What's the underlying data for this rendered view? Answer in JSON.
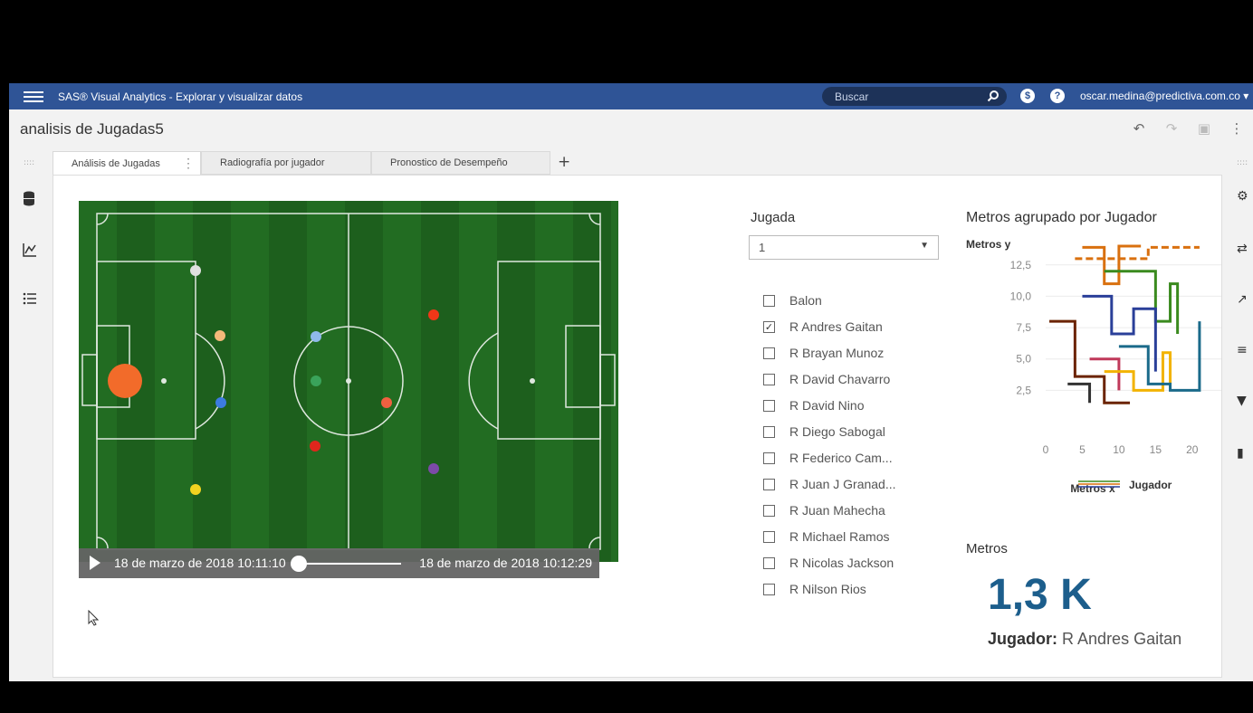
{
  "app": {
    "title": "SAS® Visual Analytics - Explorar y visualizar datos",
    "search_placeholder": "Buscar",
    "user": "oscar.medina@predictiva.com.co ▾",
    "bar_color": "#2f5496"
  },
  "document": {
    "title": "analisis de Jugadas5",
    "actions": [
      "undo-icon",
      "redo-icon",
      "save-icon",
      "more-icon"
    ]
  },
  "tabs": [
    {
      "label": "Análisis de Jugadas",
      "active": true
    },
    {
      "label": "Radiografía por jugador",
      "active": false
    },
    {
      "label": "Pronostico de Desempeño",
      "active": false
    }
  ],
  "add_tab_label": "+",
  "player": {
    "start_time": "18 de marzo de 2018 10:11:10",
    "end_time": "18 de marzo de 2018 10:12:29",
    "position_fraction": 0.0
  },
  "filter": {
    "label": "Jugada",
    "selected": "1",
    "options": [
      {
        "label": "Balon",
        "checked": false
      },
      {
        "label": "R Andres Gaitan",
        "checked": true
      },
      {
        "label": "R Brayan Munoz",
        "checked": false
      },
      {
        "label": "R David Chavarro",
        "checked": false
      },
      {
        "label": "R David Nino",
        "checked": false
      },
      {
        "label": "R Diego Sabogal",
        "checked": false
      },
      {
        "label": "R Federico Cam...",
        "checked": false
      },
      {
        "label": "R Juan J Granad...",
        "checked": false
      },
      {
        "label": "R Juan Mahecha",
        "checked": false
      },
      {
        "label": "R Michael Ramos",
        "checked": false
      },
      {
        "label": "R Nicolas Jackson",
        "checked": false
      },
      {
        "label": "R Nilson Rios",
        "checked": false
      }
    ]
  },
  "chart_data": {
    "type": "line",
    "title": "Metros agrupado por Jugador",
    "xlabel": "Metros x",
    "ylabel": "Metros y",
    "xlim": [
      0,
      22
    ],
    "ylim": [
      0,
      14
    ],
    "x_ticks": [
      "0",
      "5",
      "10",
      "15",
      "20"
    ],
    "y_ticks": [
      "2,5",
      "5,0",
      "7,5",
      "10,0",
      "12,5"
    ],
    "legend_title": "Jugador",
    "grid": true
  },
  "kpi": {
    "title": "Metros",
    "value": "1,3 K",
    "sub_label": "Jugador:",
    "sub_value": "R Andres Gaitan",
    "color": "#1c5e8c"
  }
}
